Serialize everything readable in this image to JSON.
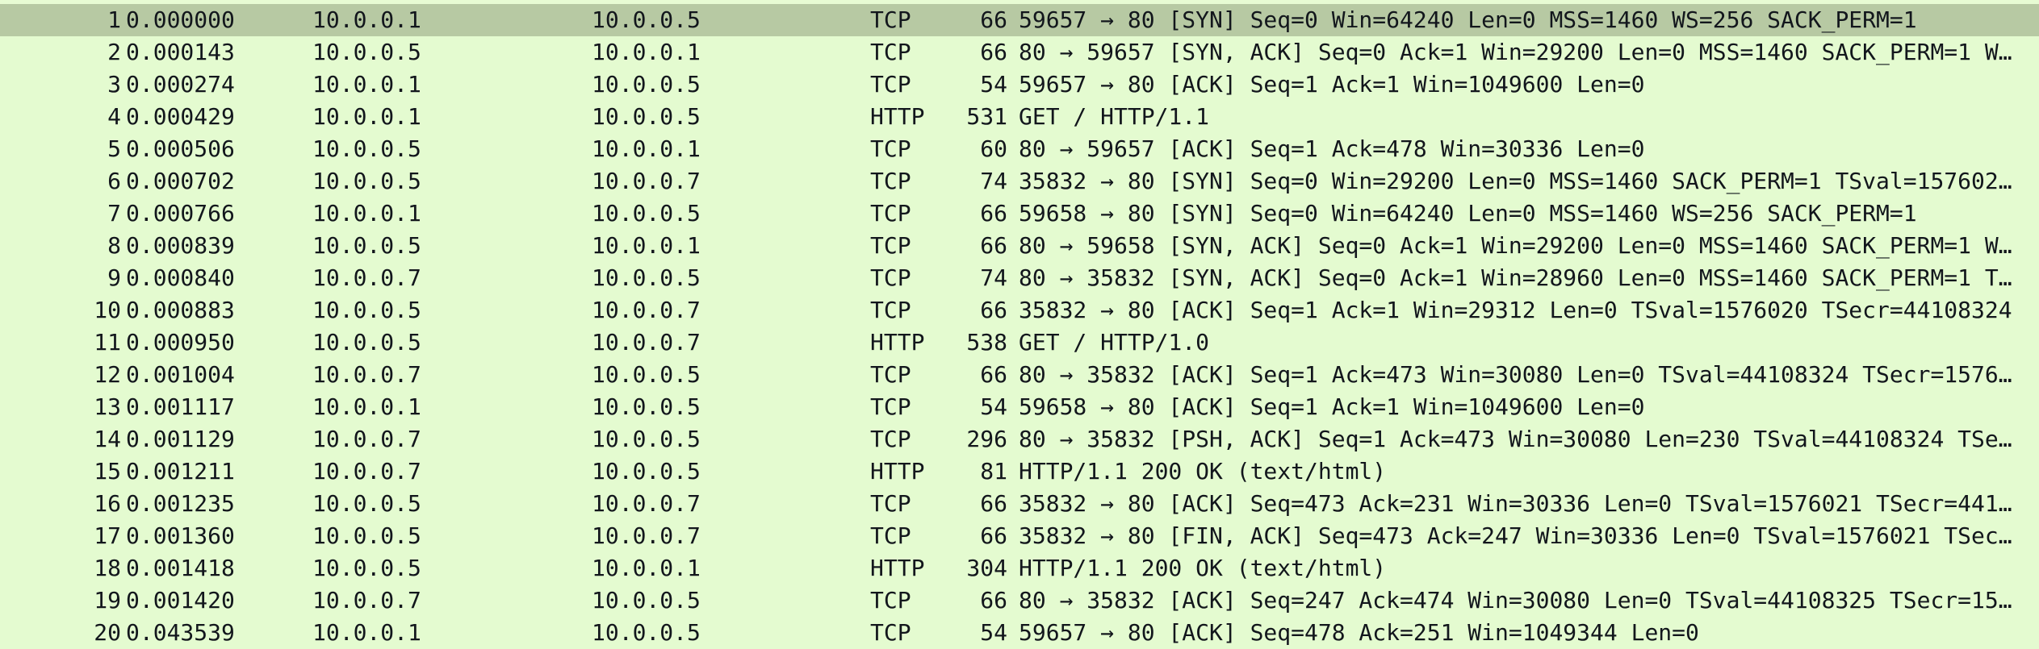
{
  "packets": [
    {
      "no": "1",
      "time": "0.000000",
      "src": "10.0.0.1",
      "dst": "10.0.0.5",
      "proto": "TCP",
      "len": "66",
      "info": "59657 → 80 [SYN] Seq=0 Win=64240 Len=0 MSS=1460 WS=256 SACK_PERM=1",
      "selected": true
    },
    {
      "no": "2",
      "time": "0.000143",
      "src": "10.0.0.5",
      "dst": "10.0.0.1",
      "proto": "TCP",
      "len": "66",
      "info": "80 → 59657 [SYN, ACK] Seq=0 Ack=1 Win=29200 Len=0 MSS=1460 SACK_PERM=1 W…"
    },
    {
      "no": "3",
      "time": "0.000274",
      "src": "10.0.0.1",
      "dst": "10.0.0.5",
      "proto": "TCP",
      "len": "54",
      "info": "59657 → 80 [ACK] Seq=1 Ack=1 Win=1049600 Len=0"
    },
    {
      "no": "4",
      "time": "0.000429",
      "src": "10.0.0.1",
      "dst": "10.0.0.5",
      "proto": "HTTP",
      "len": "531",
      "info": "GET / HTTP/1.1"
    },
    {
      "no": "5",
      "time": "0.000506",
      "src": "10.0.0.5",
      "dst": "10.0.0.1",
      "proto": "TCP",
      "len": "60",
      "info": "80 → 59657 [ACK] Seq=1 Ack=478 Win=30336 Len=0"
    },
    {
      "no": "6",
      "time": "0.000702",
      "src": "10.0.0.5",
      "dst": "10.0.0.7",
      "proto": "TCP",
      "len": "74",
      "info": "35832 → 80 [SYN] Seq=0 Win=29200 Len=0 MSS=1460 SACK_PERM=1 TSval=157602…"
    },
    {
      "no": "7",
      "time": "0.000766",
      "src": "10.0.0.1",
      "dst": "10.0.0.5",
      "proto": "TCP",
      "len": "66",
      "info": "59658 → 80 [SYN] Seq=0 Win=64240 Len=0 MSS=1460 WS=256 SACK_PERM=1"
    },
    {
      "no": "8",
      "time": "0.000839",
      "src": "10.0.0.5",
      "dst": "10.0.0.1",
      "proto": "TCP",
      "len": "66",
      "info": "80 → 59658 [SYN, ACK] Seq=0 Ack=1 Win=29200 Len=0 MSS=1460 SACK_PERM=1 W…"
    },
    {
      "no": "9",
      "time": "0.000840",
      "src": "10.0.0.7",
      "dst": "10.0.0.5",
      "proto": "TCP",
      "len": "74",
      "info": "80 → 35832 [SYN, ACK] Seq=0 Ack=1 Win=28960 Len=0 MSS=1460 SACK_PERM=1 T…"
    },
    {
      "no": "10",
      "time": "0.000883",
      "src": "10.0.0.5",
      "dst": "10.0.0.7",
      "proto": "TCP",
      "len": "66",
      "info": "35832 → 80 [ACK] Seq=1 Ack=1 Win=29312 Len=0 TSval=1576020 TSecr=44108324"
    },
    {
      "no": "11",
      "time": "0.000950",
      "src": "10.0.0.5",
      "dst": "10.0.0.7",
      "proto": "HTTP",
      "len": "538",
      "info": "GET / HTTP/1.0"
    },
    {
      "no": "12",
      "time": "0.001004",
      "src": "10.0.0.7",
      "dst": "10.0.0.5",
      "proto": "TCP",
      "len": "66",
      "info": "80 → 35832 [ACK] Seq=1 Ack=473 Win=30080 Len=0 TSval=44108324 TSecr=1576…"
    },
    {
      "no": "13",
      "time": "0.001117",
      "src": "10.0.0.1",
      "dst": "10.0.0.5",
      "proto": "TCP",
      "len": "54",
      "info": "59658 → 80 [ACK] Seq=1 Ack=1 Win=1049600 Len=0"
    },
    {
      "no": "14",
      "time": "0.001129",
      "src": "10.0.0.7",
      "dst": "10.0.0.5",
      "proto": "TCP",
      "len": "296",
      "info": "80 → 35832 [PSH, ACK] Seq=1 Ack=473 Win=30080 Len=230 TSval=44108324 TSe…"
    },
    {
      "no": "15",
      "time": "0.001211",
      "src": "10.0.0.7",
      "dst": "10.0.0.5",
      "proto": "HTTP",
      "len": "81",
      "info": "HTTP/1.1 200 OK  (text/html)"
    },
    {
      "no": "16",
      "time": "0.001235",
      "src": "10.0.0.5",
      "dst": "10.0.0.7",
      "proto": "TCP",
      "len": "66",
      "info": "35832 → 80 [ACK] Seq=473 Ack=231 Win=30336 Len=0 TSval=1576021 TSecr=441…"
    },
    {
      "no": "17",
      "time": "0.001360",
      "src": "10.0.0.5",
      "dst": "10.0.0.7",
      "proto": "TCP",
      "len": "66",
      "info": "35832 → 80 [FIN, ACK] Seq=473 Ack=247 Win=30336 Len=0 TSval=1576021 TSec…"
    },
    {
      "no": "18",
      "time": "0.001418",
      "src": "10.0.0.5",
      "dst": "10.0.0.1",
      "proto": "HTTP",
      "len": "304",
      "info": "HTTP/1.1 200 OK  (text/html)"
    },
    {
      "no": "19",
      "time": "0.001420",
      "src": "10.0.0.7",
      "dst": "10.0.0.5",
      "proto": "TCP",
      "len": "66",
      "info": "80 → 35832 [ACK] Seq=247 Ack=474 Win=30080 Len=0 TSval=44108325 TSecr=15…"
    },
    {
      "no": "20",
      "time": "0.043539",
      "src": "10.0.0.1",
      "dst": "10.0.0.5",
      "proto": "TCP",
      "len": "54",
      "info": "59657 → 80 [ACK] Seq=478 Ack=251 Win=1049344 Len=0"
    }
  ],
  "colors": {
    "row_background": "#e4fbd0",
    "selected_row_background": "#b7c9a3",
    "text": "#12161c",
    "conversation_line": "#8a948a"
  }
}
